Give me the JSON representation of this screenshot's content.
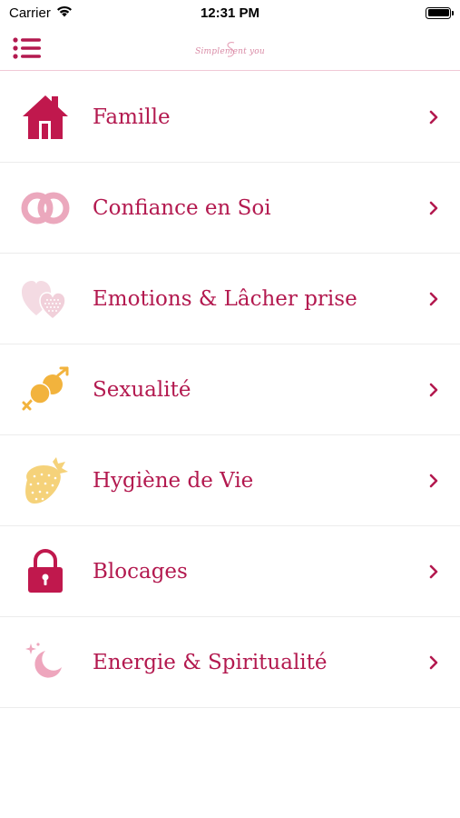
{
  "status_bar": {
    "carrier": "Carrier",
    "time": "12:31 PM"
  },
  "header": {
    "menu_icon": "list-menu-icon",
    "logo_text": "Simplement you"
  },
  "menu": {
    "items": [
      {
        "label": "Famille",
        "icon": "house-icon",
        "color": "#c0184d"
      },
      {
        "label": "Confiance en Soi",
        "icon": "rings-icon",
        "color": "#eba8bd"
      },
      {
        "label": "Emotions & Lâcher prise",
        "icon": "hearts-icon",
        "color": "#f1d0da"
      },
      {
        "label": "Sexualité",
        "icon": "gender-symbols-icon",
        "color": "#f2b33d"
      },
      {
        "label": "Hygiène de Vie",
        "icon": "strawberry-icon",
        "color": "#f5d27a"
      },
      {
        "label": "Blocages",
        "icon": "padlock-icon",
        "color": "#c0184d"
      },
      {
        "label": "Energie & Spiritualité",
        "icon": "moon-icon",
        "color": "#eea6bd"
      }
    ]
  },
  "colors": {
    "accent": "#b3194f",
    "divider": "#ececec",
    "header_border": "#f1c9d6"
  }
}
